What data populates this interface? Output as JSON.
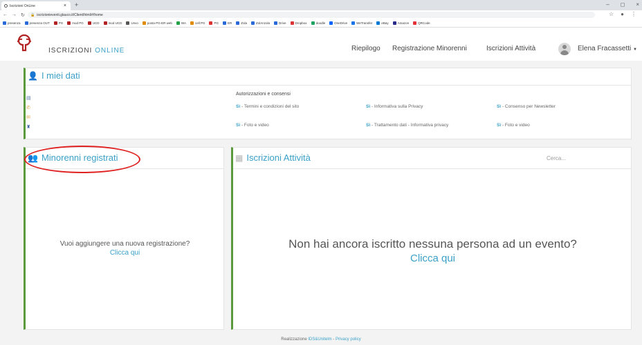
{
  "browser": {
    "tab_title": "Iscrizioni OnLine",
    "url": "iscrizionieventi.glauco.it/Client/html/#/home",
    "bookmarks": [
      "presenza",
      "presenza OUT",
      "PG",
      "mod PG",
      "UCD",
      "mod UCD",
      "Unvo",
      "posta PG-ER web",
      "WA",
      "cell PG",
      "PG",
      "ER",
      "Zola",
      "ZolAnzola",
      "Drive",
      "Dropbox",
      "doodle",
      "OneDrive",
      "WeTransfer",
      "eBay",
      "Amazon",
      "QRCode"
    ]
  },
  "header": {
    "brand_prefix": "ISCRIZIONI ",
    "brand_accent": "ONLINE",
    "nav": [
      "Riepilogo",
      "Registrazione Minorenni",
      "Iscrizioni Attività"
    ],
    "user_name": "Elena Fracassetti"
  },
  "miei_dati": {
    "title": "I miei dati",
    "consents_title": "Autorizzazioni e consensi",
    "consents": [
      {
        "flag": "Sì",
        "text": " - Termini e condizioni del sito"
      },
      {
        "flag": "Sì",
        "text": " - Informativa sulla Privacy"
      },
      {
        "flag": "Sì",
        "text": " - Consenso per Newsletter"
      },
      {
        "flag": "Sì",
        "text": " - Foto e video"
      },
      {
        "flag": "Sì",
        "text": " - Trattamento dati - Informativa privacy"
      },
      {
        "flag": "Sì",
        "text": " - Foto e video"
      }
    ]
  },
  "minorenni": {
    "title": "Minorenni registrati",
    "empty_text": "Vuoi aggiungere una nuova registrazione?",
    "link": "Clicca qui"
  },
  "attivita": {
    "title": "Iscrizioni Attività",
    "search_placeholder": "Cerca...",
    "empty_text": "Non hai ancora iscritto nessuna persona ad un evento?",
    "link": "Clicca qui"
  },
  "footer": {
    "prefix": "Realizzazione ",
    "company": "IDS&Unitelm",
    "separator": " - ",
    "privacy": "Privacy policy"
  },
  "colors": {
    "accent": "#3aa0c8",
    "card_border": "#5b9a3c",
    "annotation": "#e02020"
  }
}
